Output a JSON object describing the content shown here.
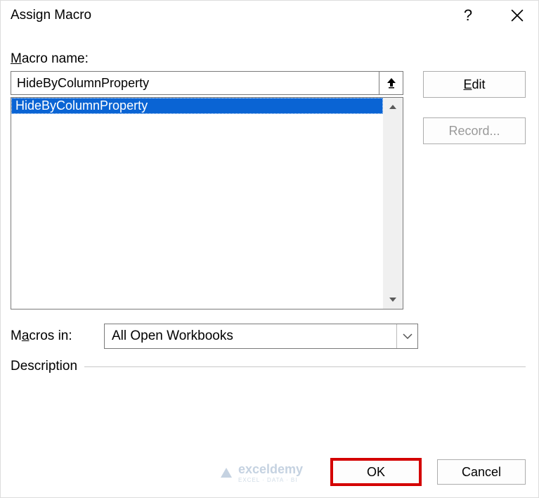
{
  "title": "Assign Macro",
  "labels": {
    "macro_name": "Macro name:",
    "macros_in": "Macros in:",
    "description": "Description"
  },
  "name_input": {
    "value": "HideByColumnProperty"
  },
  "list": {
    "items": [
      "HideByColumnProperty"
    ],
    "selected_index": 0
  },
  "macros_in_select": {
    "value": "All Open Workbooks"
  },
  "buttons": {
    "edit": "Edit",
    "record": "Record...",
    "ok": "OK",
    "cancel": "Cancel"
  },
  "watermark": {
    "brand": "exceldemy",
    "tagline": "EXCEL · DATA · BI"
  }
}
